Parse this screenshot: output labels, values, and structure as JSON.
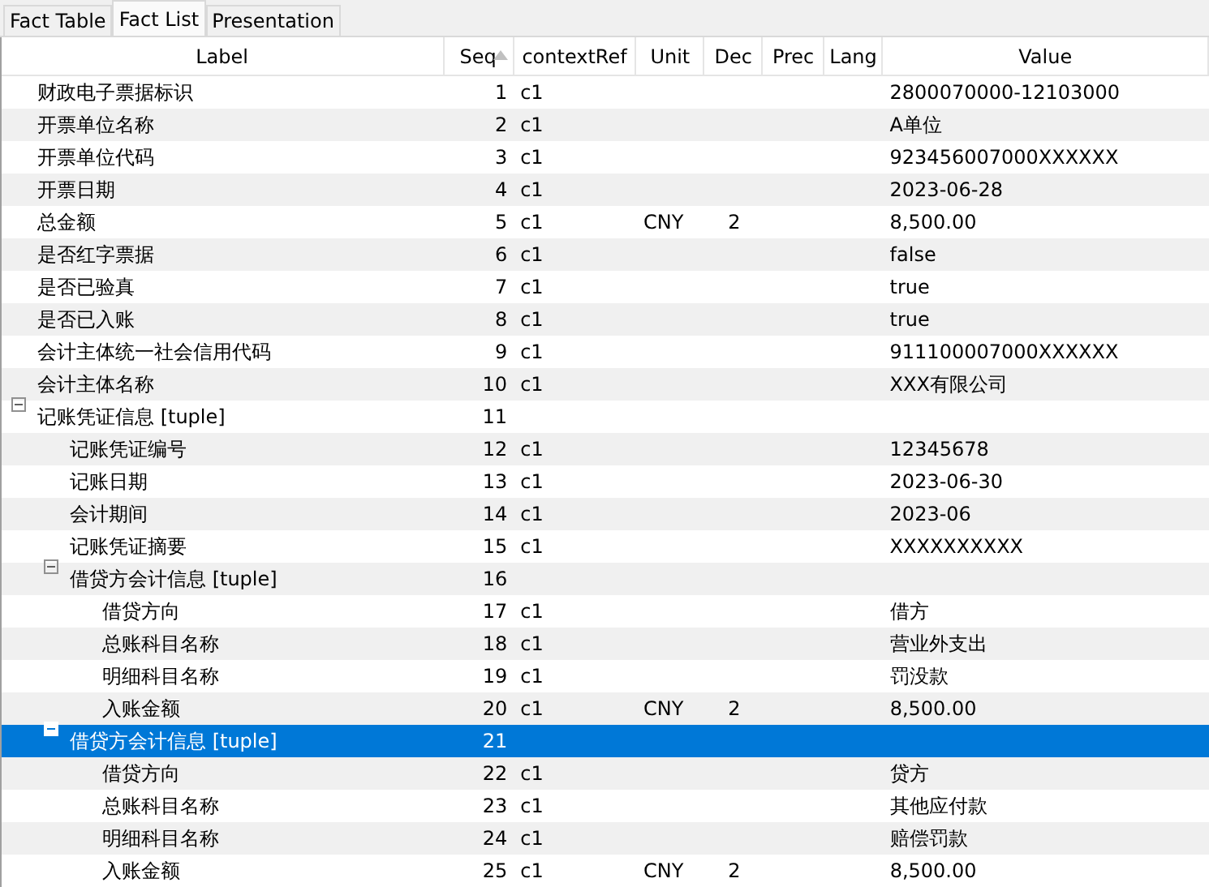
{
  "tabs": [
    {
      "label": "Fact Table",
      "selected": false
    },
    {
      "label": "Fact List",
      "selected": true
    },
    {
      "label": "Presentation",
      "selected": false
    }
  ],
  "table": {
    "columns": [
      {
        "label": "Label",
        "sorted": false
      },
      {
        "label": "Seq",
        "sorted": true
      },
      {
        "label": "contextRef",
        "sorted": false
      },
      {
        "label": "Unit",
        "sorted": false
      },
      {
        "label": "Dec",
        "sorted": false
      },
      {
        "label": "Prec",
        "sorted": false
      },
      {
        "label": "Lang",
        "sorted": false
      },
      {
        "label": "Value",
        "sorted": false
      }
    ],
    "rows": [
      {
        "label": "财政电子票据标识",
        "seq": "1",
        "context": "c1",
        "value": "2800070000-12103000",
        "selected": false
      },
      {
        "label": "开票单位名称",
        "seq": "2",
        "context": "c1",
        "value": "A单位",
        "selected": false
      },
      {
        "label": "开票单位代码",
        "seq": "3",
        "context": "c1",
        "value": "923456007000XXXXXX",
        "selected": false
      },
      {
        "label": "开票日期",
        "seq": "4",
        "context": "c1",
        "value": "2023-06-28",
        "selected": false
      },
      {
        "label": "总金额",
        "seq": "5",
        "context": "c1",
        "unit": "CNY",
        "dec": "2",
        "value": "8,500.00",
        "selected": false
      },
      {
        "label": "是否红字票据",
        "seq": "6",
        "context": "c1",
        "value": "false",
        "selected": false
      },
      {
        "label": "是否已验真",
        "seq": "7",
        "context": "c1",
        "value": "true",
        "selected": false
      },
      {
        "label": "是否已入账",
        "seq": "8",
        "context": "c1",
        "value": "true",
        "selected": false
      },
      {
        "label": "会计主体统一社会信用代码",
        "seq": "9",
        "context": "c1",
        "value": "911100007000XXXXXX",
        "selected": false
      },
      {
        "label": "会计主体名称",
        "seq": "10",
        "context": "c1",
        "value": "XXX有限公司",
        "selected": false
      },
      {
        "label": "记账凭证信息 [tuple]",
        "seq": "11",
        "selected": false,
        "expanded": true,
        "children": [
          {
            "label": "记账凭证编号",
            "seq": "12",
            "context": "c1",
            "value": "12345678",
            "selected": false
          },
          {
            "label": "记账日期",
            "seq": "13",
            "context": "c1",
            "value": "2023-06-30",
            "selected": false
          },
          {
            "label": "会计期间",
            "seq": "14",
            "context": "c1",
            "value": "2023-06",
            "selected": false
          },
          {
            "label": "记账凭证摘要",
            "seq": "15",
            "context": "c1",
            "value": "XXXXXXXXXX",
            "selected": false
          },
          {
            "label": "借贷方会计信息 [tuple]",
            "seq": "16",
            "selected": false,
            "expanded": true,
            "children": [
              {
                "label": "借贷方向",
                "seq": "17",
                "context": "c1",
                "value": "借方",
                "selected": false
              },
              {
                "label": "总账科目名称",
                "seq": "18",
                "context": "c1",
                "value": "营业外支出",
                "selected": false
              },
              {
                "label": "明细科目名称",
                "seq": "19",
                "context": "c1",
                "value": "罚没款",
                "selected": false
              },
              {
                "label": "入账金额",
                "seq": "20",
                "context": "c1",
                "unit": "CNY",
                "dec": "2",
                "value": "8,500.00",
                "selected": false
              }
            ]
          },
          {
            "label": "借贷方会计信息 [tuple]",
            "seq": "21",
            "selected": true,
            "expanded": true,
            "children": [
              {
                "label": "借贷方向",
                "seq": "22",
                "context": "c1",
                "value": "贷方",
                "selected": false
              },
              {
                "label": "总账科目名称",
                "seq": "23",
                "context": "c1",
                "value": "其他应付款",
                "selected": false
              },
              {
                "label": "明细科目名称",
                "seq": "24",
                "context": "c1",
                "value": "赔偿罚款",
                "selected": false
              },
              {
                "label": "入账金额",
                "seq": "25",
                "context": "c1",
                "unit": "CNY",
                "dec": "2",
                "value": "8,500.00",
                "selected": false
              }
            ]
          }
        ]
      }
    ]
  }
}
